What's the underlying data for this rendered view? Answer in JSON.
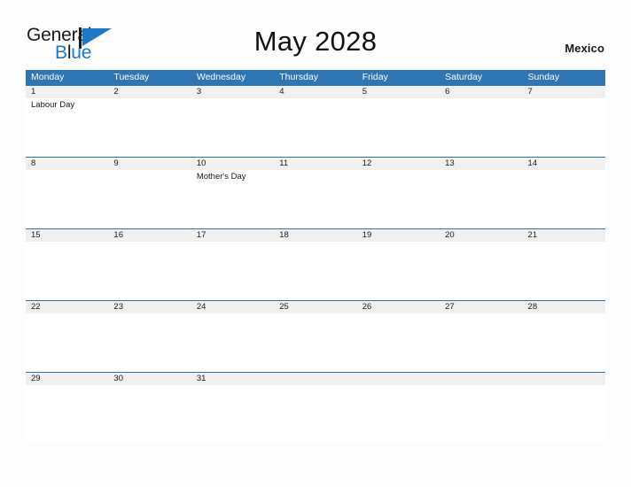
{
  "brand": {
    "name_part1": "General",
    "name_part2_lead": "B",
    "name_part2_l": "l",
    "name_part2_rest": "ue",
    "flag_icon": "blue-flag-triangle-icon",
    "accent_color": "#1b79c9"
  },
  "header": {
    "title": "May 2028",
    "country": "Mexico",
    "header_bg_color": "#2e75b6",
    "date_band_color": "#f0f0f0"
  },
  "weekdays": [
    "Monday",
    "Tuesday",
    "Wednesday",
    "Thursday",
    "Friday",
    "Saturday",
    "Sunday"
  ],
  "weeks": [
    {
      "days": [
        {
          "date": "1",
          "event": "Labour Day"
        },
        {
          "date": "2",
          "event": ""
        },
        {
          "date": "3",
          "event": ""
        },
        {
          "date": "4",
          "event": ""
        },
        {
          "date": "5",
          "event": ""
        },
        {
          "date": "6",
          "event": ""
        },
        {
          "date": "7",
          "event": ""
        }
      ]
    },
    {
      "days": [
        {
          "date": "8",
          "event": ""
        },
        {
          "date": "9",
          "event": ""
        },
        {
          "date": "10",
          "event": "Mother's Day"
        },
        {
          "date": "11",
          "event": ""
        },
        {
          "date": "12",
          "event": ""
        },
        {
          "date": "13",
          "event": ""
        },
        {
          "date": "14",
          "event": ""
        }
      ]
    },
    {
      "days": [
        {
          "date": "15",
          "event": ""
        },
        {
          "date": "16",
          "event": ""
        },
        {
          "date": "17",
          "event": ""
        },
        {
          "date": "18",
          "event": ""
        },
        {
          "date": "19",
          "event": ""
        },
        {
          "date": "20",
          "event": ""
        },
        {
          "date": "21",
          "event": ""
        }
      ]
    },
    {
      "days": [
        {
          "date": "22",
          "event": ""
        },
        {
          "date": "23",
          "event": ""
        },
        {
          "date": "24",
          "event": ""
        },
        {
          "date": "25",
          "event": ""
        },
        {
          "date": "26",
          "event": ""
        },
        {
          "date": "27",
          "event": ""
        },
        {
          "date": "28",
          "event": ""
        }
      ]
    },
    {
      "days": [
        {
          "date": "29",
          "event": ""
        },
        {
          "date": "30",
          "event": ""
        },
        {
          "date": "31",
          "event": ""
        },
        {
          "date": "",
          "event": ""
        },
        {
          "date": "",
          "event": ""
        },
        {
          "date": "",
          "event": ""
        },
        {
          "date": "",
          "event": ""
        }
      ]
    }
  ]
}
